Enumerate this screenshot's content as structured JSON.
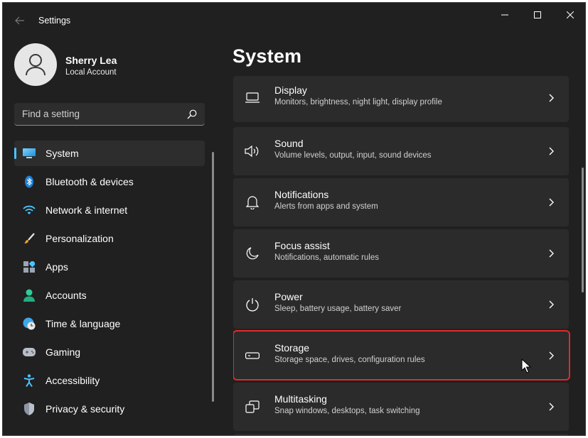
{
  "window": {
    "title": "Settings"
  },
  "profile": {
    "name": "Sherry Lea",
    "account_type": "Local Account"
  },
  "search": {
    "placeholder": "Find a setting",
    "value": ""
  },
  "sidebar": {
    "items": [
      {
        "label": "System",
        "icon": "system-icon",
        "active": true
      },
      {
        "label": "Bluetooth & devices",
        "icon": "bluetooth-icon"
      },
      {
        "label": "Network & internet",
        "icon": "wifi-icon"
      },
      {
        "label": "Personalization",
        "icon": "brush-icon"
      },
      {
        "label": "Apps",
        "icon": "apps-icon"
      },
      {
        "label": "Accounts",
        "icon": "accounts-icon"
      },
      {
        "label": "Time & language",
        "icon": "clock-globe-icon"
      },
      {
        "label": "Gaming",
        "icon": "gamepad-icon"
      },
      {
        "label": "Accessibility",
        "icon": "accessibility-icon"
      },
      {
        "label": "Privacy & security",
        "icon": "shield-icon"
      }
    ]
  },
  "main": {
    "title": "System",
    "cards": [
      {
        "title": "Display",
        "subtitle": "Monitors, brightness, night light, display profile",
        "icon": "monitor-icon"
      },
      {
        "title": "Sound",
        "subtitle": "Volume levels, output, input, sound devices",
        "icon": "speaker-icon"
      },
      {
        "title": "Notifications",
        "subtitle": "Alerts from apps and system",
        "icon": "bell-icon"
      },
      {
        "title": "Focus assist",
        "subtitle": "Notifications, automatic rules",
        "icon": "moon-icon"
      },
      {
        "title": "Power",
        "subtitle": "Sleep, battery usage, battery saver",
        "icon": "power-icon"
      },
      {
        "title": "Storage",
        "subtitle": "Storage space, drives, configuration rules",
        "icon": "drive-icon",
        "highlighted": true
      },
      {
        "title": "Multitasking",
        "subtitle": "Snap windows, desktops, task switching",
        "icon": "multitask-icon"
      }
    ]
  },
  "colors": {
    "background": "#202020",
    "card": "#2b2b2b",
    "accent": "#4cc2ff",
    "highlight_border": "#e12b2b"
  }
}
